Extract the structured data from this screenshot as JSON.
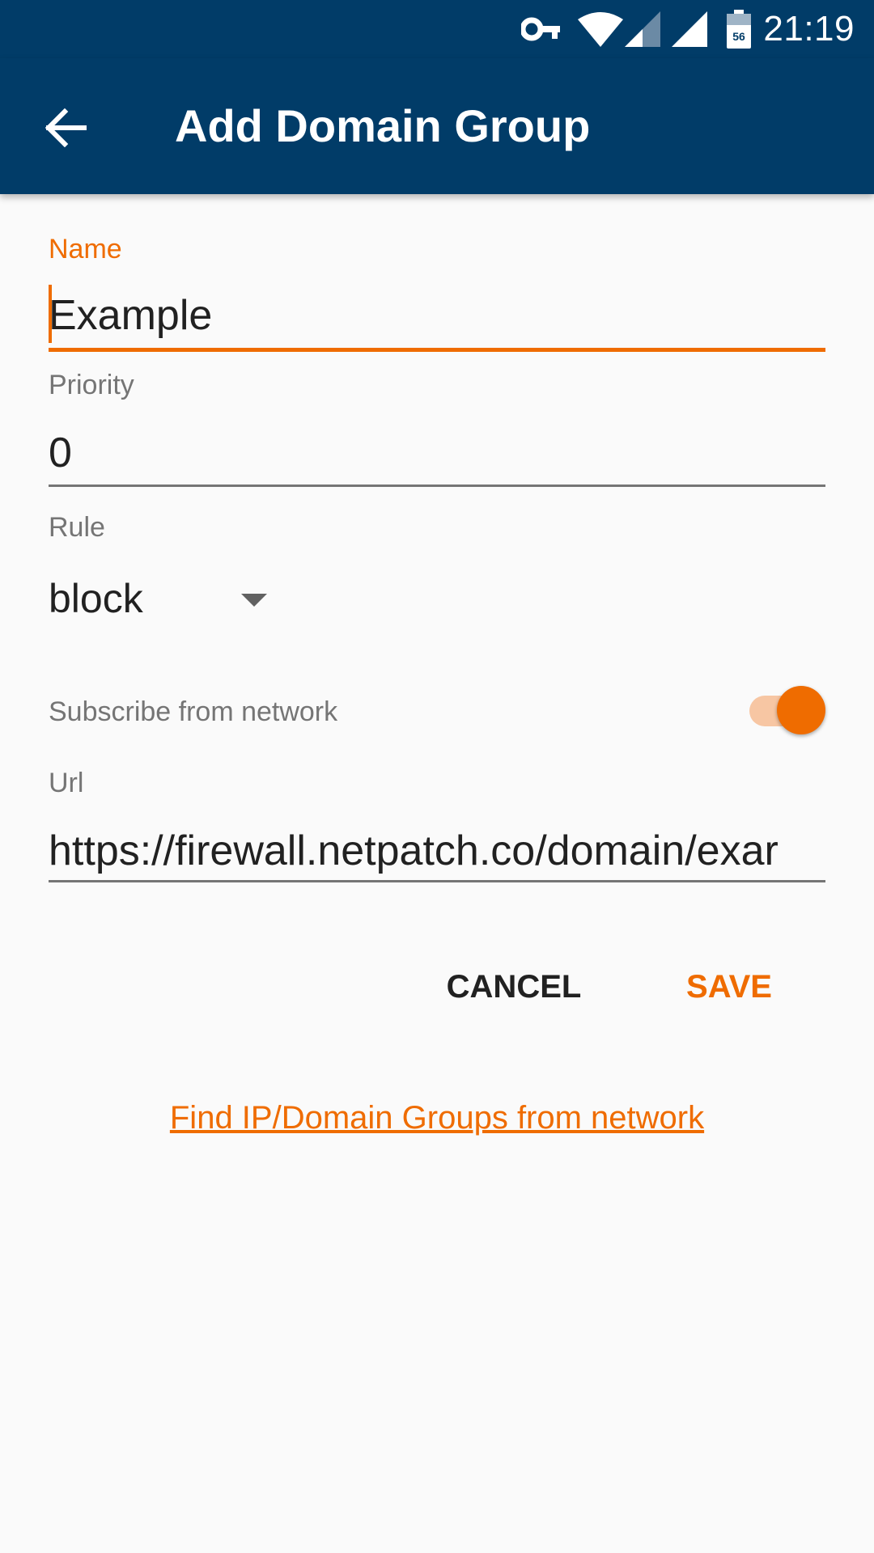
{
  "status_bar": {
    "time": "21:19",
    "battery_level": "56",
    "icons": [
      "vpn-key-icon",
      "wifi-icon",
      "signal-icon",
      "signal-full-icon",
      "battery-icon"
    ]
  },
  "app_bar": {
    "title": "Add Domain Group",
    "back_icon": "arrow-back-icon",
    "background_color": "#013c68"
  },
  "form": {
    "name": {
      "label": "Name",
      "value": "Example"
    },
    "priority": {
      "label": "Priority",
      "value": "0"
    },
    "rule": {
      "label": "Rule",
      "selected": "block"
    },
    "subscribe": {
      "label": "Subscribe from network",
      "checked": true
    },
    "url": {
      "label": "Url",
      "value": "https://firewall.netpatch.co/domain/exar"
    }
  },
  "actions": {
    "cancel_label": "CANCEL",
    "save_label": "SAVE"
  },
  "footer_link": "Find IP/Domain Groups from network",
  "colors": {
    "accent": "#ef6c00",
    "primary": "#013c68"
  }
}
